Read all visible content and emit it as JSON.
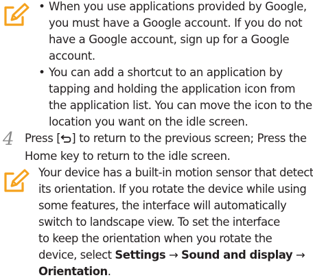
{
  "colors": {
    "note_icon": "#f5a21e",
    "text": "#231f20",
    "step_number": "#8a8a8a"
  },
  "bullets": [
    {
      "lines": [
        "When you use applications provided by Google,",
        "you must have a Google account. If you do not",
        "have a Google account, sign up for a Google",
        "account."
      ]
    },
    {
      "lines": [
        "You can add a shortcut to an application by",
        "tapping and holding the application icon from",
        "the application list. You can move the icon to the",
        "location you want on the idle screen."
      ]
    }
  ],
  "step": {
    "number": "4",
    "line1_before": "Press [",
    "line1_after": "] to return to the previous screen; Press the",
    "line2": "Home key to return to the idle screen."
  },
  "note": {
    "lines": [
      "Your device has a built-in motion sensor that detects",
      "its orientation. If you rotate the device while using",
      "some features, the interface will automatically",
      "switch to landscape view. To set the interface",
      "to keep the orientation when you rotate the"
    ],
    "line6_before": "device, select ",
    "setting_1": "Settings",
    "arrow": "→",
    "setting_2": "Sound and display",
    "setting_3": "Orientation",
    "period": "."
  }
}
